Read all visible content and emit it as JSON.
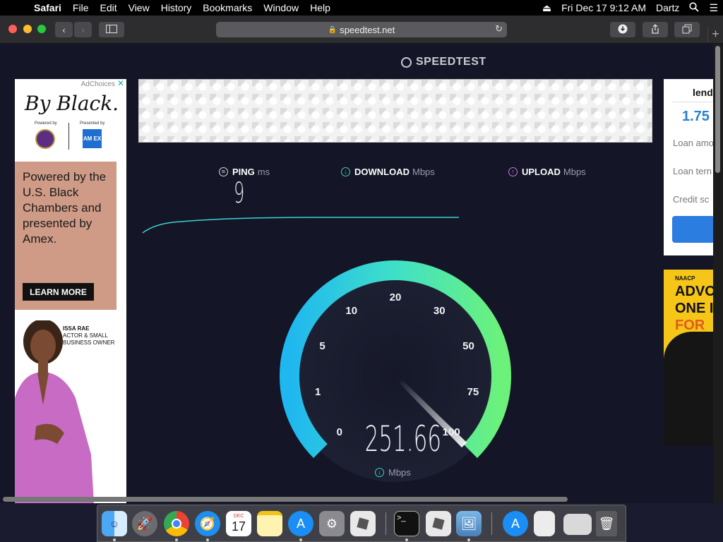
{
  "menubar": {
    "app": "Safari",
    "items": [
      "File",
      "Edit",
      "View",
      "History",
      "Bookmarks",
      "Window",
      "Help"
    ],
    "datetime": "Fri Dec 17  9:12 AM",
    "user": "Dartz"
  },
  "toolbar": {
    "url": "speedtest.net"
  },
  "speedtest": {
    "logo": "SPEEDTEST",
    "ping_label": "PING",
    "ping_unit": "ms",
    "ping_value": "9",
    "download_label": "DOWNLOAD",
    "download_unit": "Mbps",
    "upload_label": "UPLOAD",
    "upload_unit": "Mbps",
    "gauge": {
      "ticks": [
        "0",
        "1",
        "5",
        "10",
        "20",
        "30",
        "50",
        "75",
        "100"
      ],
      "value": "251.66",
      "unit": "Mbps",
      "needle_position": 1.0
    }
  },
  "ad_left": {
    "adchoices": "AdChoices",
    "brand": "By Black.",
    "powered_by": "Powered by",
    "presented_by": "Presented by",
    "amex_logo": "AM EX",
    "body": "Powered by the U.S. Black Chambers and presented by Amex.",
    "cta": "LEARN MORE",
    "person_name": "ISSA RAE",
    "person_title": "ACTOR & SMALL BUSINESS OWNER"
  },
  "ad_right_top": {
    "brand": "lend",
    "rate": "1.75",
    "fields": [
      "Loan amo",
      "Loan tern",
      "Credit sc"
    ]
  },
  "ad_right_bottom": {
    "org": "NAACP",
    "line1": "ADVO",
    "line2": "ONE I",
    "line3": "FOR V"
  },
  "dock": {
    "apps": [
      "finder-icon",
      "launchpad-icon",
      "chrome-icon",
      "safari-icon",
      "calendar-icon",
      "notes-icon",
      "app-store-icon",
      "system-preferences-icon",
      "roblox-icon",
      "terminal-icon",
      "roblox-studio-icon",
      "preview-icon",
      "app-store-2-icon",
      "file-icon",
      "screenshot-icon",
      "trash-icon"
    ],
    "calendar_month": "DEC",
    "calendar_day": "17"
  }
}
